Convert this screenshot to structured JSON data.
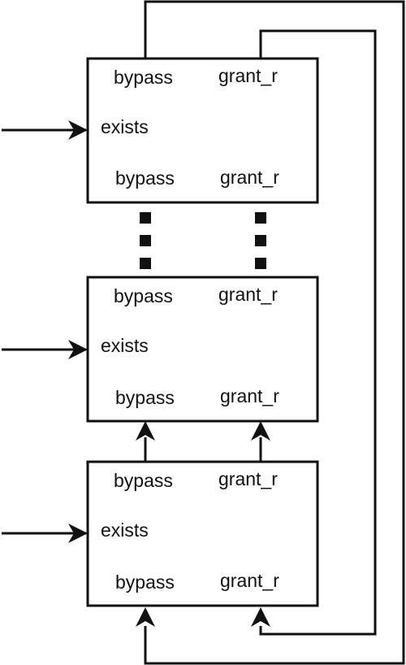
{
  "colors": {
    "stroke": "#111111",
    "background": "#ffffff"
  },
  "blocks": [
    {
      "top_left_label": "bypass",
      "top_right_label": "grant_r",
      "input_label": "exists",
      "bottom_left_label": "bypass",
      "bottom_right_label": "grant_r"
    },
    {
      "top_left_label": "bypass",
      "top_right_label": "grant_r",
      "input_label": "exists",
      "bottom_left_label": "bypass",
      "bottom_right_label": "grant_r"
    },
    {
      "top_left_label": "bypass",
      "top_right_label": "grant_r",
      "input_label": "exists",
      "bottom_left_label": "bypass",
      "bottom_right_label": "grant_r"
    }
  ]
}
